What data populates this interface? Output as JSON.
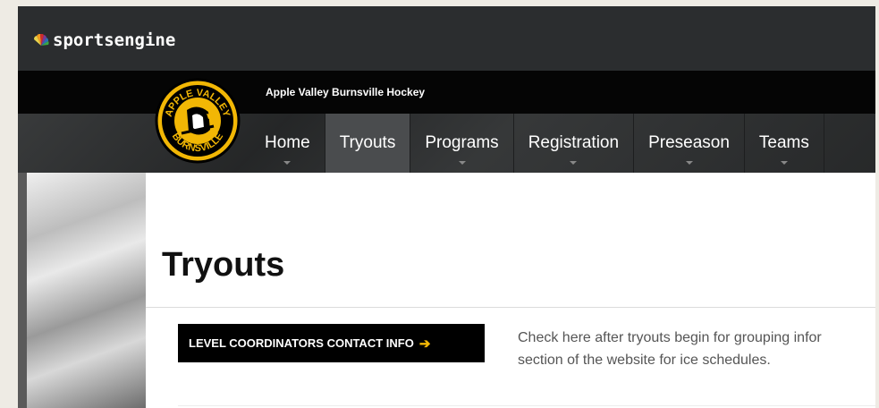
{
  "platform": {
    "brand": "sportsengine"
  },
  "club": {
    "name": "Apple Valley Burnsville Hockey",
    "logo_text_top": "APPLE VALLEY",
    "logo_text_bottom": "BURNSVILLE"
  },
  "nav": {
    "items": [
      {
        "label": "Home",
        "active": false
      },
      {
        "label": "Tryouts",
        "active": true
      },
      {
        "label": "Programs",
        "active": false
      },
      {
        "label": "Registration",
        "active": false
      },
      {
        "label": "Preseason",
        "active": false
      },
      {
        "label": "Teams",
        "active": false
      }
    ]
  },
  "page": {
    "title": "Tryouts",
    "cta_label": "LEVEL COORDINATORS CONTACT INFO",
    "cta_icon": "arrow-right-icon",
    "body_line1": "Check here after tryouts begin for grouping infor",
    "body_line2": "section of the website for ice schedules."
  },
  "colors": {
    "accent": "#f2b705",
    "topbar": "#2b2d2f",
    "clubbar": "#050505",
    "nav": "#2e3031"
  }
}
